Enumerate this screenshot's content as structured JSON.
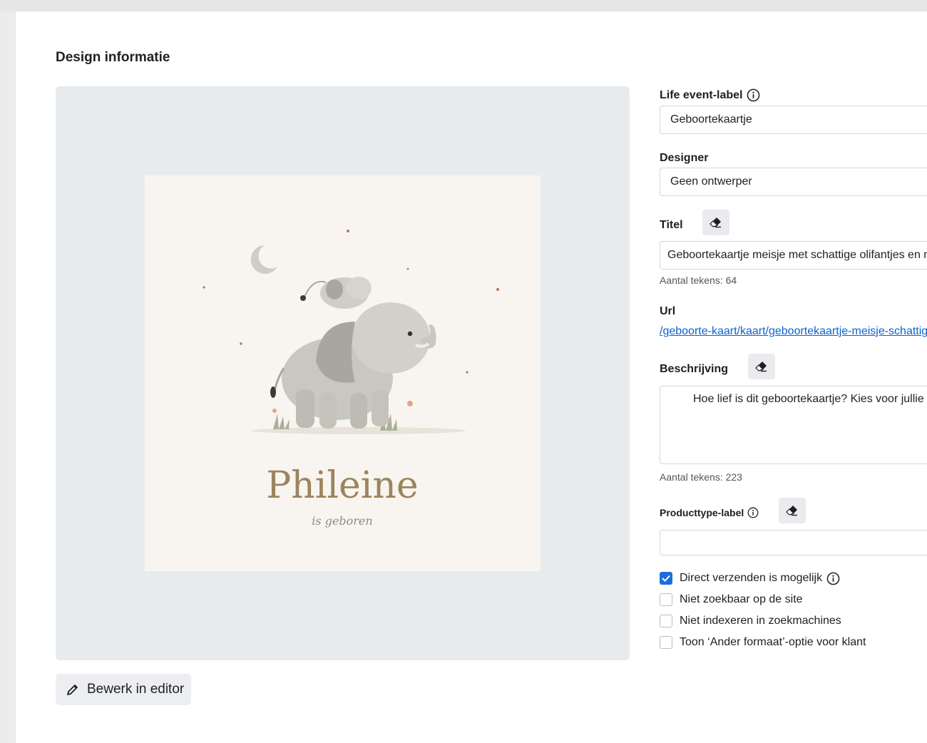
{
  "section": {
    "title": "Design informatie"
  },
  "preview": {
    "art_name": "Phileine",
    "art_subtitle": "is geboren"
  },
  "edit_button": {
    "label": "Bewerk in editor",
    "icon": "pencil-icon"
  },
  "form": {
    "life_event": {
      "label": "Life event-label",
      "value": "Geboortekaartje"
    },
    "designer": {
      "label": "Designer",
      "value": "Geen ontwerper"
    },
    "titel": {
      "label": "Titel",
      "value": "Geboortekaartje meisje met schattige olifantjes en m",
      "count": "Aantal tekens: 64"
    },
    "url": {
      "label": "Url",
      "value": "/geboorte-kaart/kaart/geboortekaartje-meisje-schattig"
    },
    "beschrijving": {
      "label": "Beschrijving",
      "value": "Hoe lief is dit geboortekaartje? Kies voor jullie",
      "count": "Aantal tekens: 223"
    },
    "producttype": {
      "label": "Producttype-label",
      "value": ""
    },
    "checkboxes": [
      {
        "label": "Direct verzenden is mogelijk",
        "checked": true
      },
      {
        "label": "Niet zoekbaar op de site",
        "checked": false
      },
      {
        "label": "Niet indexeren in zoekmachines",
        "checked": false
      },
      {
        "label": "Toon ‘Ander formaat’-optie voor klant",
        "checked": false
      }
    ]
  },
  "colors": {
    "accent": "#1a6fe0",
    "link": "#0b63ce",
    "panel": "#e8ebee"
  }
}
